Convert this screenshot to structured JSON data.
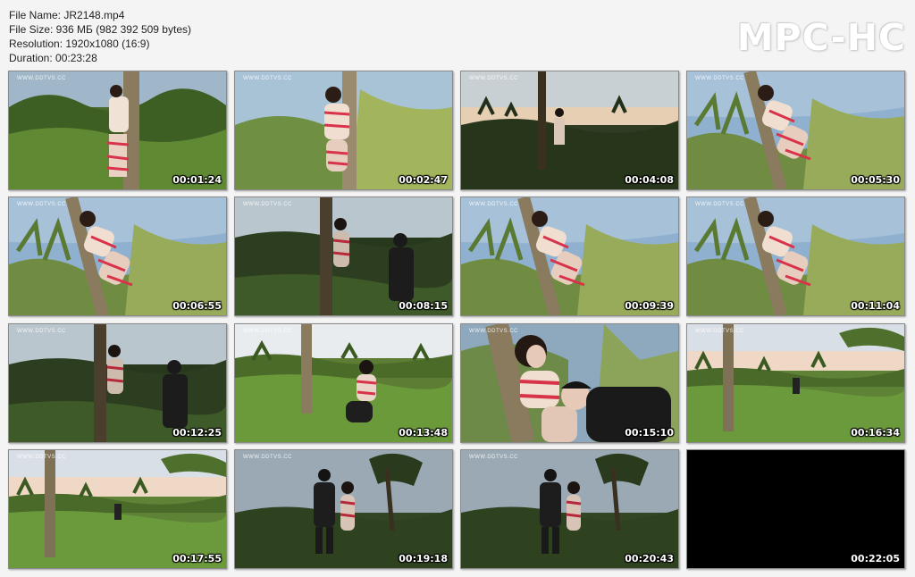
{
  "file_info": {
    "name_line": "File Name: JR2148.mp4",
    "size_line": "File Size: 936 МБ (982 392 509 bytes)",
    "resolution_line": "Resolution: 1920x1080 (16:9)",
    "duration_line": "Duration: 00:23:28"
  },
  "logo": "MPC-HC",
  "watermark": "WWW.DDTVS.CC",
  "thumbnails": [
    {
      "time": "00:01:24",
      "scene": "tree-day"
    },
    {
      "time": "00:02:47",
      "scene": "tree-close"
    },
    {
      "time": "00:04:08",
      "scene": "dusk-far"
    },
    {
      "time": "00:05:30",
      "scene": "palm-sky"
    },
    {
      "time": "00:06:55",
      "scene": "palm-sky"
    },
    {
      "time": "00:08:15",
      "scene": "dusk-man"
    },
    {
      "time": "00:09:39",
      "scene": "palm-sky"
    },
    {
      "time": "00:11:04",
      "scene": "palm-sky"
    },
    {
      "time": "00:12:25",
      "scene": "dusk-man"
    },
    {
      "time": "00:13:48",
      "scene": "field-crouch"
    },
    {
      "time": "00:15:10",
      "scene": "closeup"
    },
    {
      "time": "00:16:34",
      "scene": "wide-field"
    },
    {
      "time": "00:17:55",
      "scene": "wide-field"
    },
    {
      "time": "00:19:18",
      "scene": "twilight"
    },
    {
      "time": "00:20:43",
      "scene": "twilight"
    },
    {
      "time": "00:22:05",
      "scene": "black"
    }
  ]
}
